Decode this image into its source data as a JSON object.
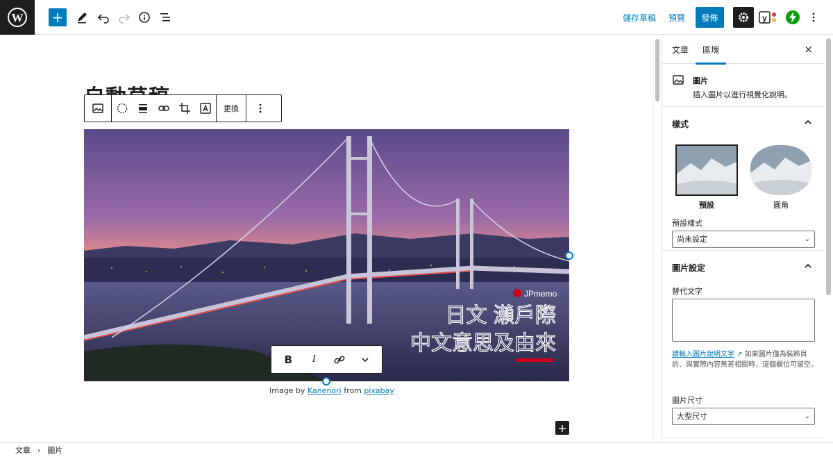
{
  "header": {
    "save_draft": "儲存草稿",
    "preview": "預覽",
    "publish": "發佈",
    "add_block": "+"
  },
  "editor": {
    "post_title": "自動草稿",
    "toolbar_replace": "更換",
    "caption": {
      "prefix": "Image by ",
      "author": "Kanenori",
      "middle": " from ",
      "source": "pixabay"
    },
    "format": {
      "bold": "B",
      "italic": "I"
    },
    "image_overlay": {
      "brand": "JPmemo",
      "line1": "日文 瀨戶際",
      "line2": "中文意思及由來"
    },
    "inserter": "+"
  },
  "sidebar": {
    "tabs": [
      "文章",
      "區塊"
    ],
    "close": "×",
    "block_card": {
      "title": "圖片",
      "description": "插入圖片以進行視覺化說明。"
    },
    "styles_panel": {
      "title": "樣式",
      "options": [
        "預設",
        "圓角"
      ],
      "default_style_label": "預設樣式",
      "default_style_value": "尚未設定"
    },
    "image_settings_panel": {
      "title": "圖片設定",
      "alt_label": "替代文字",
      "help_link": "請輸入圖片說明文字",
      "help_text": "如果圖片僅為裝飾目的、與實際內容無甚相關時，這個欄位可留空。",
      "size_label": "圖片尺寸",
      "size_value": "大型尺寸"
    }
  },
  "breadcrumbs": [
    "文章",
    "圖片"
  ],
  "colors": {
    "accent": "#007cba",
    "dark": "#1e1e1e",
    "overlay_red": "#d0021b"
  }
}
